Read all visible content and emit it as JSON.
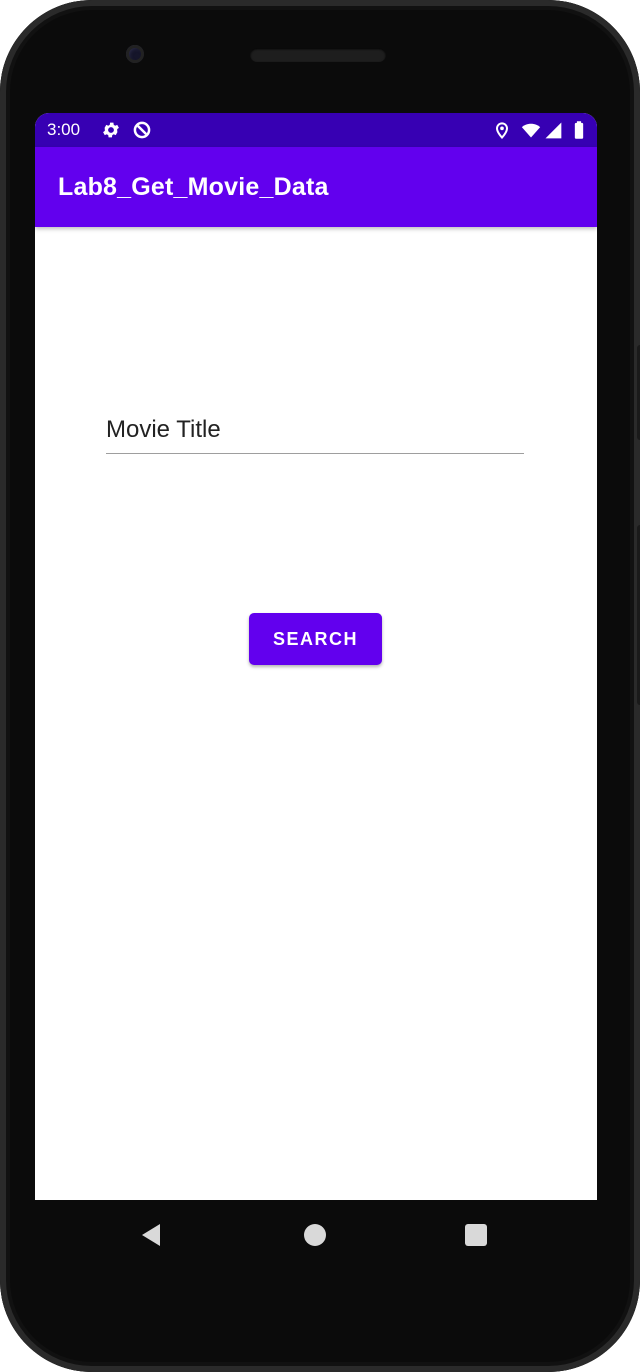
{
  "status_bar": {
    "time": "3:00",
    "icons": [
      "settings-icon",
      "sync-icon",
      "location-icon",
      "wifi-icon",
      "signal-icon",
      "battery-icon"
    ]
  },
  "app_bar": {
    "title": "Lab8_Get_Movie_Data"
  },
  "form": {
    "title_placeholder": "Movie Title",
    "title_value": "",
    "search_label": "SEARCH"
  },
  "nav_bar": {
    "icons": [
      "back-icon",
      "home-icon",
      "recents-icon"
    ]
  },
  "colors": {
    "status_bar": "#3700b3",
    "primary": "#6200ee",
    "on_primary": "#ffffff",
    "nav_icons": "#d9d9d9"
  }
}
